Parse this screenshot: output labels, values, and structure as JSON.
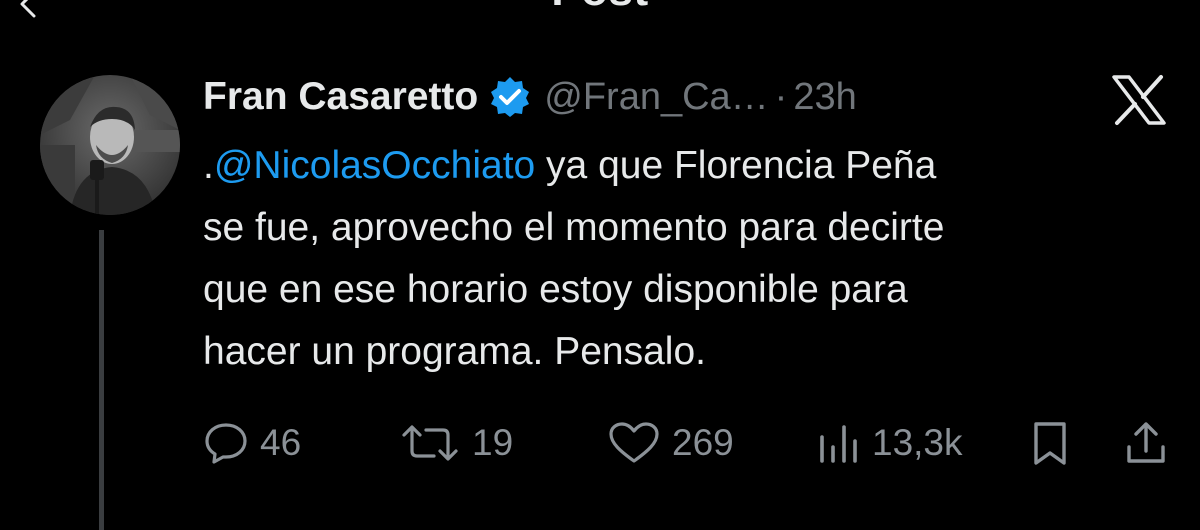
{
  "header": {
    "title": "Post"
  },
  "tweet": {
    "author_name": "Fran Casaretto",
    "handle": "@Fran_Ca…",
    "separator": "·",
    "time": "23h",
    "body": {
      "prefix": ".",
      "mention": "@NicolasOcchiato",
      "line1_rest": " ya que Florencia Peña",
      "line2": "se fue, aprovecho el momento para decirte",
      "line3": "que en ese horario estoy disponible para",
      "line4": "hacer un programa. Pensalo."
    },
    "actions": {
      "replies": "46",
      "reposts": "19",
      "likes": "269",
      "views": "13,3k"
    }
  },
  "colors": {
    "background": "#000000",
    "text": "#e7e9ea",
    "secondary": "#71767b",
    "accent": "#1d9bf0",
    "thread_line": "#3a3d40"
  },
  "icons": {
    "back": "arrow-left-icon",
    "verified": "verified-badge-icon",
    "platform": "x-logo-icon",
    "reply": "speech-bubble-icon",
    "repost": "repost-arrows-icon",
    "like": "heart-icon",
    "views": "bar-chart-icon",
    "bookmark": "bookmark-icon",
    "share": "share-upload-icon"
  }
}
